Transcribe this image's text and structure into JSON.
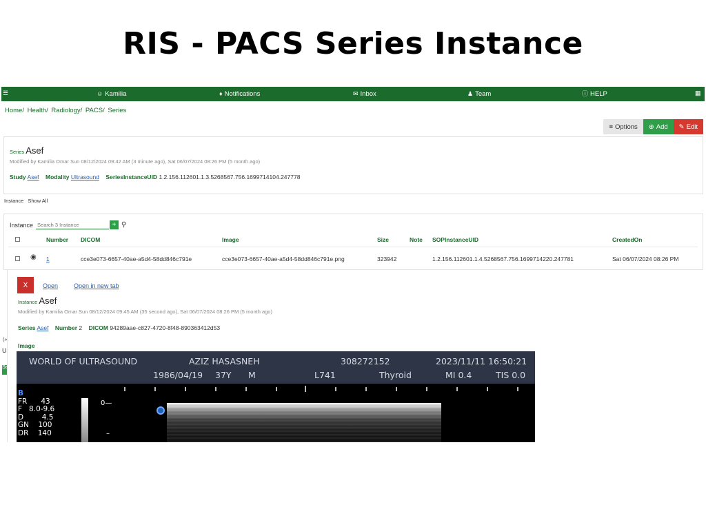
{
  "page_title": "RIS - PACS Series Instance",
  "nav": {
    "user": "Kamilia",
    "notifications": "Notifications",
    "inbox": "Inbox",
    "team": "Team",
    "help": "HELP"
  },
  "breadcrumb": [
    "Home/",
    "Health/",
    "Radiology/",
    "PACS/",
    "Series"
  ],
  "toolbar": {
    "options": "Options",
    "add": "Add",
    "edit": "Edit"
  },
  "series": {
    "label": "Series",
    "name": "Asef",
    "modified": "Modified by Kamilia Omar Sun 08/12/2024 09:42 AM (3 minute ago), Sat 06/07/2024 08:26 PM (5 month ago)",
    "study_label": "Study",
    "study_value": "Asef",
    "modality_label": "Modality",
    "modality_value": "Ultrasound",
    "uid_label": "SeriesInstanceUID",
    "uid_value": "1.2.156.112601.1.3.5268567.756.1699714104.247778"
  },
  "subtabs": [
    "Instance",
    "Show All"
  ],
  "instances": {
    "label": "Instance",
    "search_placeholder": "Search 3 Instance",
    "plus": "+",
    "columns": [
      "Number",
      "DICOM",
      "Image",
      "Size",
      "Note",
      "SOPInstanceUID",
      "CreatedOn"
    ],
    "rows": [
      {
        "number": "1",
        "dicom": "cce3e073-6657-40ae-a5d4-58dd846c791e",
        "image": "cce3e073-6657-40ae-a5d4-58dd846c791e.png",
        "size": "323942",
        "note": "",
        "sop_uid": "1.2.156.112601.1.4.5268567.756.1699714220.247781",
        "created_on": "Sat 06/07/2024 08:26 PM"
      }
    ]
  },
  "overlay": {
    "close": "X",
    "open": "Open",
    "open_new_tab": "Open in new tab",
    "label": "Instance",
    "name": "Asef",
    "modified": "Modified by Kamilia Omar Sun 08/12/2024 09:45 AM (35 second ago), Sat 06/07/2024 08:26 PM (5 month ago)",
    "series_label": "Series",
    "series_value": "Asef",
    "number_label": "Number",
    "number_value": "2",
    "dicom_label": "DICOM",
    "dicom_value": "94289aae-c827-4720-8f48-890363412d53",
    "image_label": "Image"
  },
  "ultrasound": {
    "institution": "WORLD OF ULTRASOUND",
    "patient": "AZIZ HASASNEH",
    "id": "308272152",
    "datetime": "2023/11/11 16:50:21",
    "dob": "1986/04/19",
    "age": "37Y",
    "sex": "M",
    "probe": "L741",
    "exam": "Thyroid",
    "mi": "MI 0.4",
    "tis": "TIS 0.0",
    "mode": "B",
    "params": [
      "FR      43",
      "F   8.0-9.6",
      "D        4.5",
      "GN    100",
      "DR    140"
    ],
    "depth_zero": "0—",
    "depth_mark": "–"
  },
  "edge_fragments": [
    "(»)",
    "Us",
    "Se"
  ]
}
